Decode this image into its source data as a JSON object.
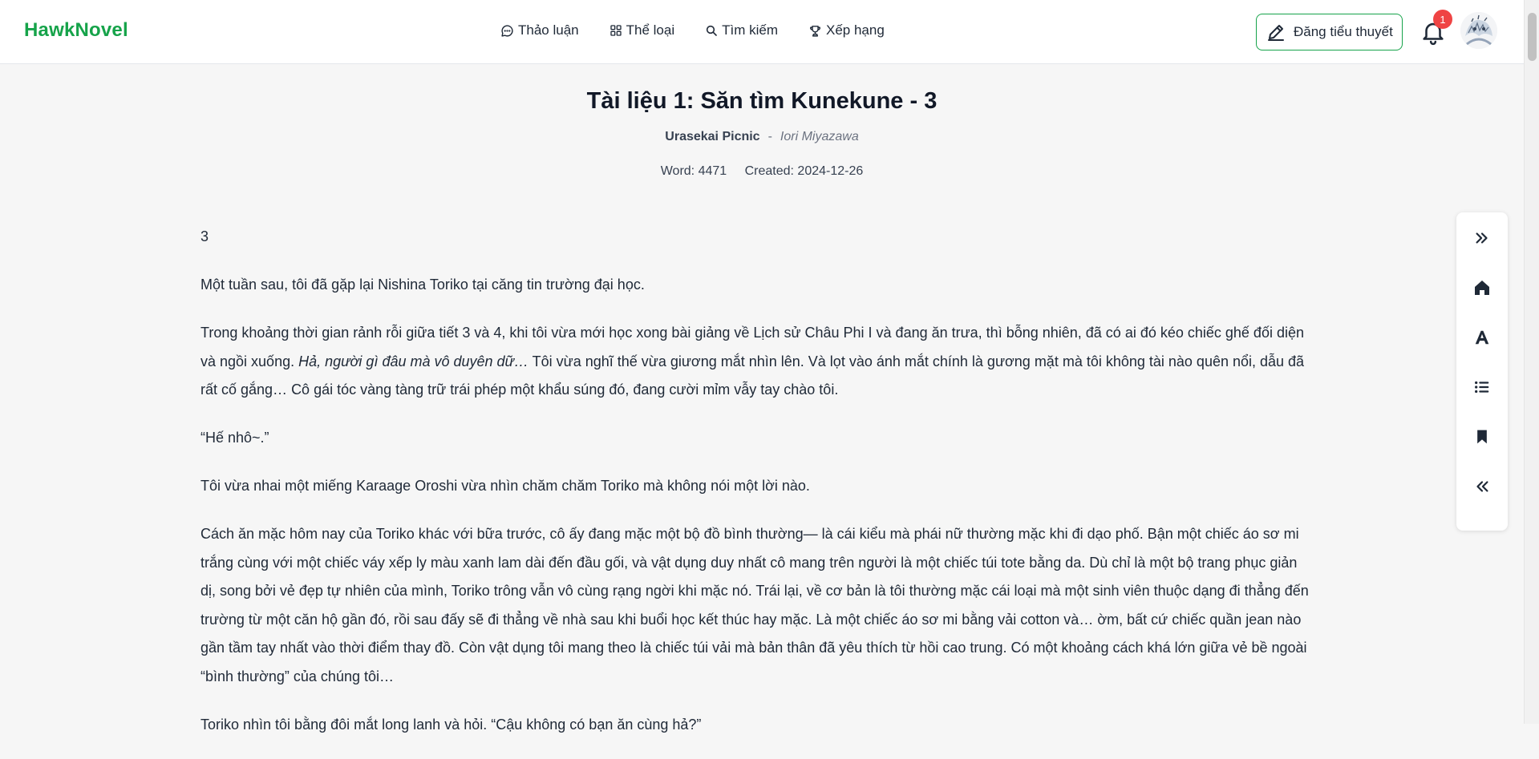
{
  "header": {
    "logo": "HawkNovel",
    "nav": [
      {
        "label": "Thảo luận",
        "icon": "chat-bubble-icon"
      },
      {
        "label": "Thể loại",
        "icon": "grid-icon"
      },
      {
        "label": "Tìm kiếm",
        "icon": "search-icon"
      },
      {
        "label": "Xếp hạng",
        "icon": "trophy-icon"
      }
    ],
    "write_button": "Đăng tiểu thuyết",
    "notification_count": "1"
  },
  "chapter": {
    "title": "Tài liệu 1: Săn tìm Kunekune - 3",
    "novel": "Urasekai Picnic",
    "separator": "-",
    "author": "Iori Miyazawa",
    "word_count": "Word: 4471",
    "created": "Created: 2024-12-26"
  },
  "body": {
    "paragraphs": [
      "3",
      "Một tuần sau, tôi đã gặp lại Nishina Toriko tại căng tin trường đại học.",
      "Trong khoảng thời gian rảnh rỗi giữa tiết 3 và 4, khi tôi vừa mới học xong bài giảng về Lịch sử Châu Phi I và đang ăn trưa, thì bỗng nhiên, đã có ai đó kéo chiếc ghế đối diện và ngồi xuống.",
      "Hả, người gì đâu mà vô duyên dữ…",
      "Tôi vừa nghĩ thế vừa giương mắt nhìn lên. Và lọt vào ánh mắt chính là gương mặt mà tôi không tài nào quên nổi, dẫu đã rất cố gắng… Cô gái tóc vàng tàng trữ trái phép một khẩu súng đó, đang cười mỉm vẫy tay chào tôi.",
      "“Hế nhô~.”",
      "Tôi vừa nhai một miếng Karaage Oroshi vừa nhìn chăm chăm Toriko mà không nói một lời nào.",
      "Cách ăn mặc hôm nay của Toriko khác với bữa trước, cô ấy đang mặc một bộ đồ bình thường— là cái kiểu mà phái nữ thường mặc khi đi dạo phố. Bận một chiếc áo sơ mi trắng cùng với một chiếc váy xếp ly màu xanh lam dài đến đầu gối, và vật dụng duy nhất cô mang trên người là một chiếc túi tote bằng da. Dù chỉ là một bộ trang phục giản dị, song bởi vẻ đẹp tự nhiên của mình, Toriko trông vẫn vô cùng rạng ngời khi mặc nó. Trái lại, về cơ bản là tôi thường mặc cái loại mà một sinh viên thuộc dạng đi thẳng đến trường từ một căn hộ gần đó, rồi sau đấy sẽ đi thẳng về nhà sau khi buổi học kết thúc hay mặc. Là một chiếc áo sơ mi bằng vải cotton và… ờm, bất cứ chiếc quần jean nào gần tầm tay nhất vào thời điểm thay đồ. Còn vật dụng tôi mang theo là chiếc túi vải mà bản thân đã yêu thích từ hồi cao trung. Có một khoảng cách khá lớn giữa vẻ bề ngoài “bình thường” của chúng tôi…",
      "Toriko nhìn tôi bằng đôi mắt long lanh và hỏi. “Cậu không có bạn ăn cùng hả?”"
    ]
  },
  "toolbar": {
    "items": [
      "collapse-right-icon",
      "home-icon",
      "font-icon",
      "list-icon",
      "bookmark-icon",
      "collapse-left-icon"
    ]
  },
  "colors": {
    "brand": "#16a34a",
    "badge": "#ef4444",
    "background": "#f6f6f6"
  }
}
